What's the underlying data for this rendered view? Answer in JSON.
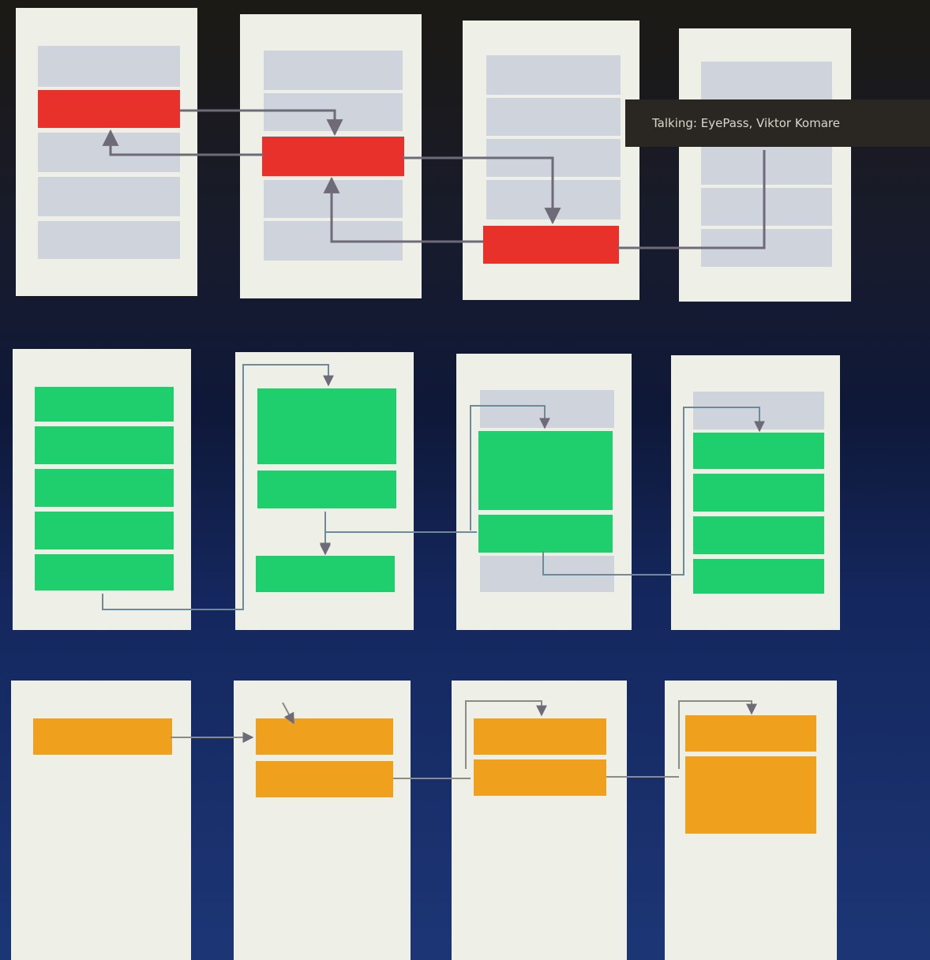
{
  "colors": {
    "red": "#e8312b",
    "green": "#1fcf6e",
    "orange": "#efa01c",
    "placeholder": "#ced3dc",
    "panel": "#eef0e7",
    "connector": "#6e6a78"
  },
  "tooltip": {
    "text": "Talking: EyePass, Viktor Komare"
  }
}
